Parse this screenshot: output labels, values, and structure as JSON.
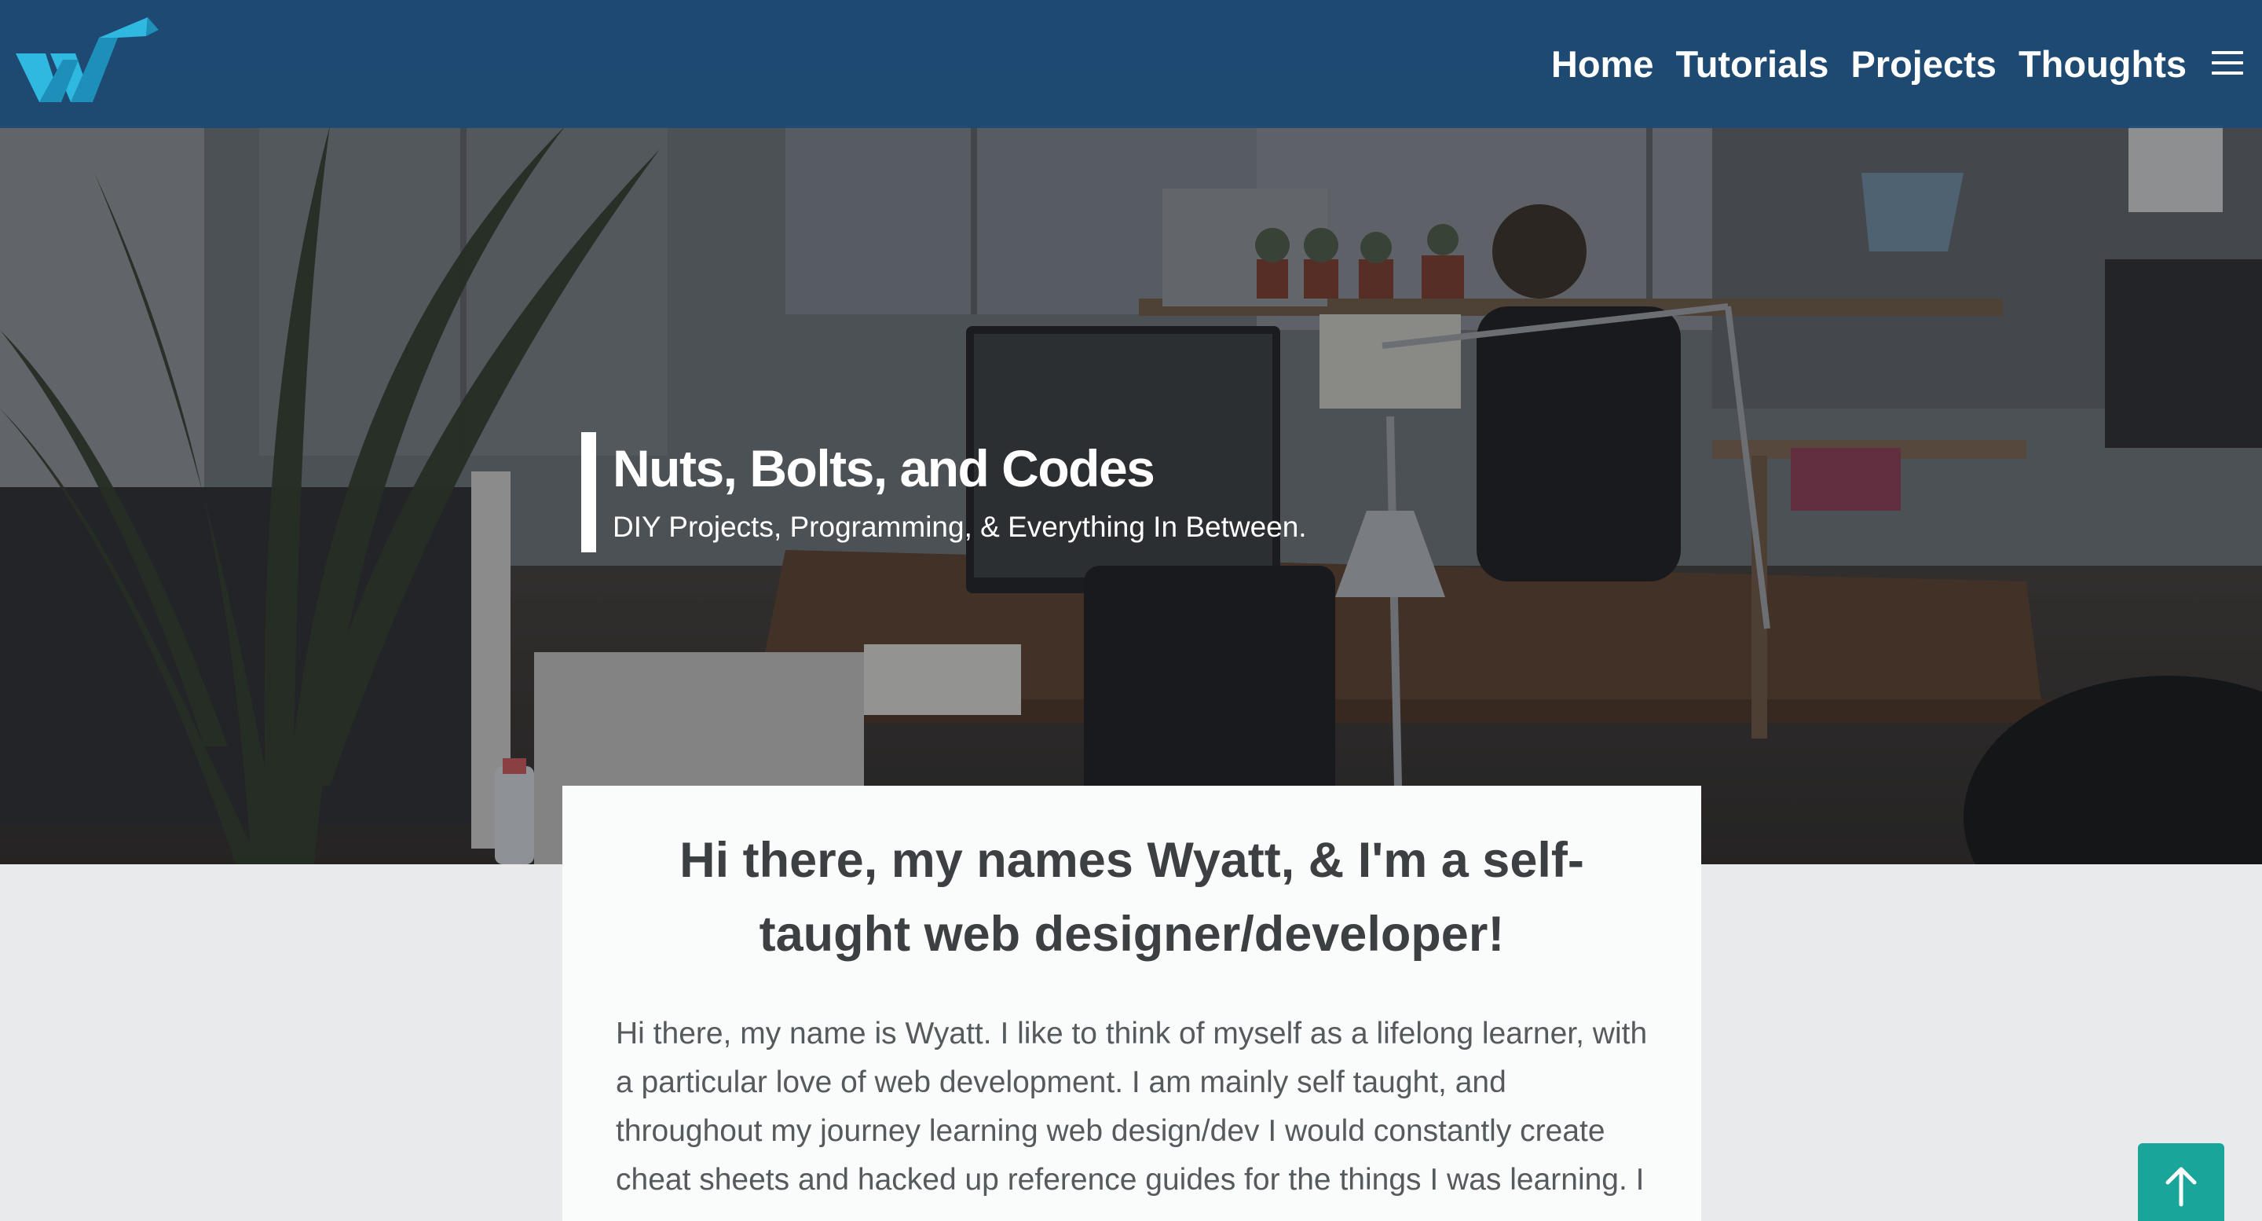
{
  "brand": {
    "logo_icon": "w-logo-icon",
    "colors": {
      "navbar": "#1b4a75",
      "logo_primary": "#2fb8e0",
      "logo_dark": "#1d8fb8",
      "accent_button": "#1aa59a",
      "card_background": "#fafbfb",
      "page_background": "#e9eaec"
    }
  },
  "nav": {
    "links": [
      "Home",
      "Tutorials",
      "Projects",
      "Thoughts"
    ],
    "menu_icon": "hamburger-menu-icon"
  },
  "hero": {
    "title": "Nuts, Bolts, and Codes",
    "subtitle": "DIY Projects, Programming, & Everything In Between."
  },
  "intro": {
    "heading": "Hi there, my names Wyatt, & I'm a self-taught web designer/developer!",
    "body": "Hi there, my name is Wyatt. I like to think of myself as a lifelong learner, with a particular love of web development.  I am mainly self taught, and throughout my journey learning web design/dev I would constantly create cheat sheets and hacked up reference guides for the things I was learning. I"
  },
  "back_to_top": {
    "icon": "arrow-up-icon"
  }
}
